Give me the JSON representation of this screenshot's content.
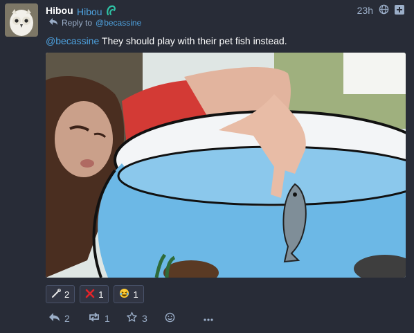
{
  "status": {
    "display_name": "Hibou",
    "username": "Hibou",
    "reply_prefix": "Reply to",
    "reply_to_mention": "@becassine",
    "timestamp": "23h",
    "content_mention": "@becassine",
    "content_text": " They should play with their pet fish instead."
  },
  "reactions": [
    {
      "icon": "wrench-icon",
      "count": "2"
    },
    {
      "icon": "red-x-icon",
      "count": "1"
    },
    {
      "icon": "laughing-emoji-icon",
      "count": "1"
    }
  ],
  "actions": {
    "reply_count": "2",
    "boost_count": "1",
    "favourite_count": "3"
  },
  "colors": {
    "background": "#282c37",
    "accent": "#4ea2df",
    "muted": "#9baec8",
    "text": "#ffffff"
  }
}
